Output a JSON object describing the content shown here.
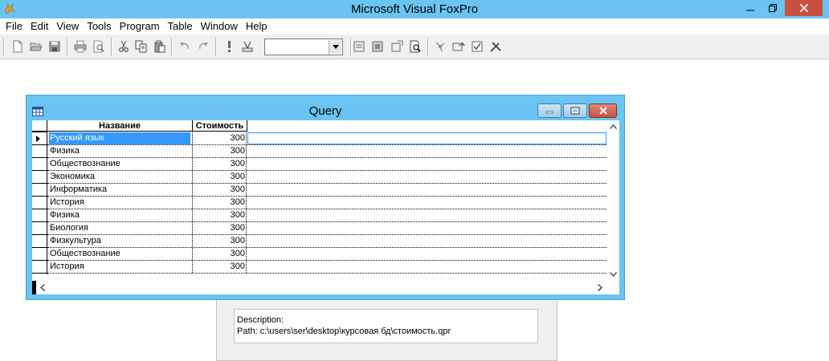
{
  "app": {
    "title": "Microsoft Visual FoxPro"
  },
  "menu": [
    "File",
    "Edit",
    "View",
    "Tools",
    "Program",
    "Table",
    "Window",
    "Help"
  ],
  "toolbar": {
    "icons": [
      "new-icon",
      "open-icon",
      "save-icon",
      "print-icon",
      "print-preview-icon",
      "cut-icon",
      "copy-icon",
      "paste-icon",
      "undo-icon",
      "redo-icon",
      "run-icon",
      "modify-form-icon",
      "form-wizard-icon",
      "report-icon",
      "database-icon",
      "command-window-icon",
      "data-session-icon",
      "code-references-icon",
      "task-list-icon",
      "toolbox-icon",
      "builder-icon"
    ],
    "combo_value": ""
  },
  "query_window": {
    "title": "Query",
    "columns": [
      "Название",
      "Стоимость"
    ],
    "rows": [
      [
        "Русский язык",
        "300"
      ],
      [
        "Физика",
        "300"
      ],
      [
        "Обществознание",
        "300"
      ],
      [
        "Экономика",
        "300"
      ],
      [
        "Информатика",
        "300"
      ],
      [
        "История",
        "300"
      ],
      [
        "Физика",
        "300"
      ],
      [
        "Биология",
        "300"
      ],
      [
        "Физкультура",
        "300"
      ],
      [
        "Обществознание",
        "300"
      ],
      [
        "История",
        "300"
      ]
    ],
    "selected_row": 0
  },
  "designer": {
    "description_label": "Description:",
    "path_label": "Path: c:\\users\\ser\\desktop\\курсовая бд\\стоимость.qpr"
  },
  "colors": {
    "titlebar": "#6ac3f0",
    "close": "#c7503f",
    "selection": "#3399ff"
  }
}
